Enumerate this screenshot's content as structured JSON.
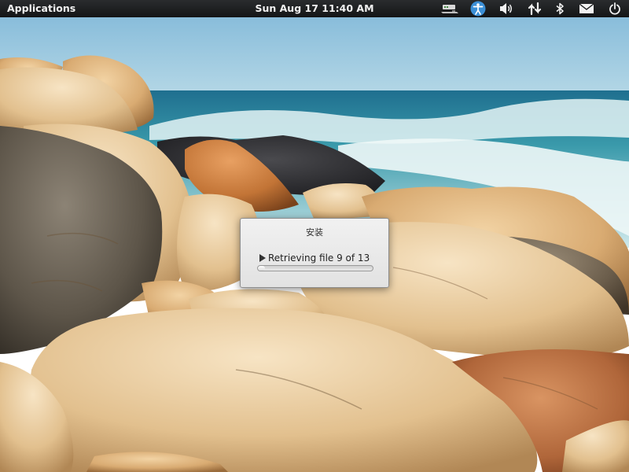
{
  "panel": {
    "applications_label": "Applications",
    "clock": "Sun Aug 17 11:40 AM",
    "indicators": [
      {
        "name": "network-wired-icon"
      },
      {
        "name": "accessibility-icon"
      },
      {
        "name": "volume-icon"
      },
      {
        "name": "data-transfer-icon"
      },
      {
        "name": "bluetooth-icon"
      },
      {
        "name": "mail-icon"
      },
      {
        "name": "power-icon"
      }
    ]
  },
  "dialog": {
    "title": "安装",
    "status": "Retrieving file 9 of 13",
    "progress_fraction": 0.0
  },
  "colors": {
    "panel_bg": "#1d1e1f",
    "accessibility_accent": "#3b8fd6"
  }
}
